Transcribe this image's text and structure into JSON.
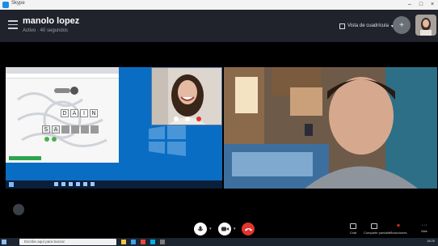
{
  "window": {
    "app_title": "Skype",
    "icons": {
      "app": "skype-icon",
      "minimize": "minimize-icon",
      "maximize": "maximize-icon",
      "close": "close-icon"
    }
  },
  "header": {
    "contact_name": "manolo lopez",
    "contact_status": "Activo · 40 segundos",
    "layout_label": "Vista de cuadrícula",
    "icons": {
      "menu": "hamburger-menu-icon",
      "layout": "grid-view-icon",
      "add_people": "add-person-icon"
    }
  },
  "screenshare": {
    "word_tiles": [
      "D",
      "A",
      "I",
      "N"
    ],
    "letter_row": [
      "S",
      "A",
      "",
      "",
      "",
      ""
    ]
  },
  "controls": {
    "right_actions": [
      {
        "label": "Chat",
        "icon": "chat-icon"
      },
      {
        "label": "Compartir pantalla",
        "icon": "share-screen-icon"
      },
      {
        "label": "Reacciones",
        "icon": "heart-icon"
      },
      {
        "label": "Más",
        "icon": "more-icon"
      }
    ],
    "icons": {
      "mic": "microphone-icon",
      "video": "video-camera-icon",
      "end": "end-call-icon"
    }
  },
  "host_taskbar": {
    "search_placeholder": "Escribe aquí para buscar",
    "time": "18:20"
  },
  "colors": {
    "header_bg": "#20232b",
    "end_call": "#e2352c",
    "share_desktop": "#0a6dc4"
  }
}
